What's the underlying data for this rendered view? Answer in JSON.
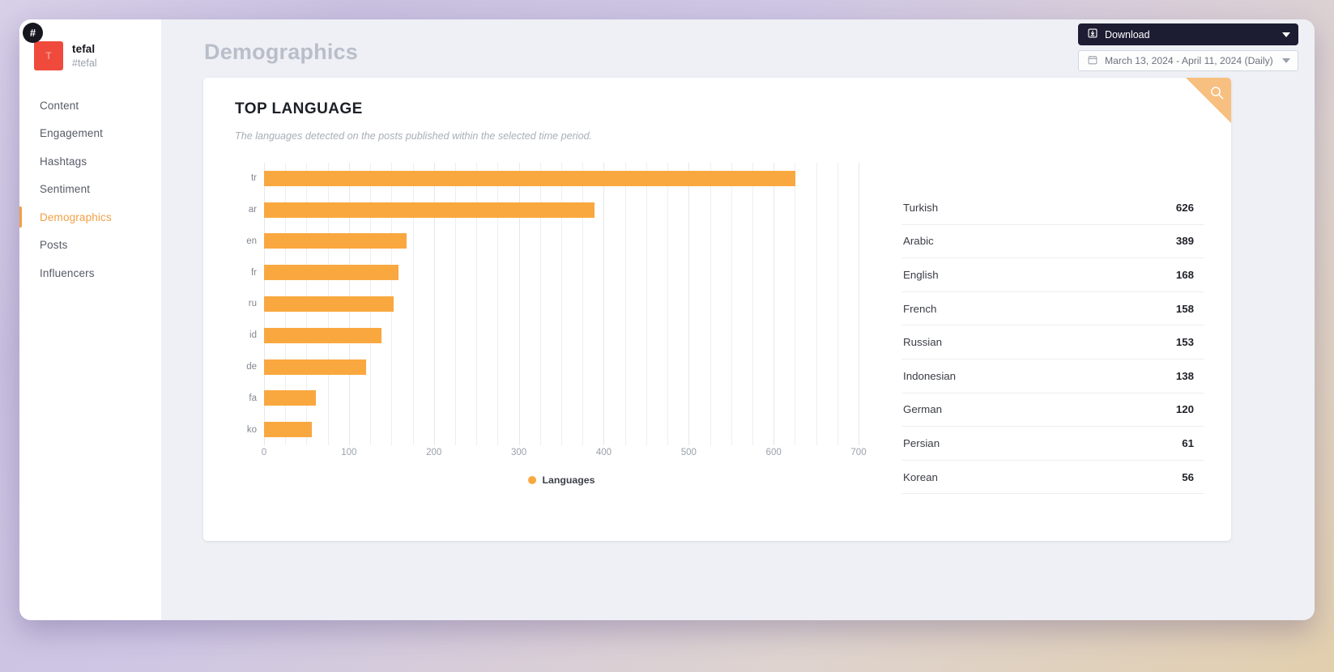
{
  "sidebar": {
    "hash_badge": "#",
    "avatar_letter": "T",
    "brand_name": "tefal",
    "brand_handle": "#tefal",
    "items": [
      {
        "label": "Content",
        "active": false
      },
      {
        "label": "Engagement",
        "active": false
      },
      {
        "label": "Hashtags",
        "active": false
      },
      {
        "label": "Sentiment",
        "active": false
      },
      {
        "label": "Demographics",
        "active": true
      },
      {
        "label": "Posts",
        "active": false
      },
      {
        "label": "Influencers",
        "active": false
      }
    ]
  },
  "header": {
    "page_title": "Demographics",
    "download_label": "Download",
    "download_icon": "download-icon",
    "date_range_label": "March 13, 2024 - April 11, 2024 (Daily)",
    "calendar_icon": "calendar-icon",
    "caret_icon": "chevron-down-icon"
  },
  "card": {
    "title": "TOP LANGUAGE",
    "subtitle": "The languages detected on the posts published within the selected time period.",
    "ribbon_icon": "search-icon"
  },
  "table": {
    "rows": [
      {
        "name": "Turkish",
        "value": "626"
      },
      {
        "name": "Arabic",
        "value": "389"
      },
      {
        "name": "English",
        "value": "168"
      },
      {
        "name": "French",
        "value": "158"
      },
      {
        "name": "Russian",
        "value": "153"
      },
      {
        "name": "Indonesian",
        "value": "138"
      },
      {
        "name": "German",
        "value": "120"
      },
      {
        "name": "Persian",
        "value": "61"
      },
      {
        "name": "Korean",
        "value": "56"
      }
    ]
  },
  "colors": {
    "bar": "#f9a83f",
    "accent": "#f0a046",
    "brand": "#ef4a3c",
    "dark": "#1c1d33"
  },
  "chart_data": {
    "type": "bar",
    "orientation": "horizontal",
    "title": "TOP LANGUAGE",
    "subtitle": "The languages detected on the posts published within the selected time period.",
    "categories": [
      "tr",
      "ar",
      "en",
      "fr",
      "ru",
      "id",
      "de",
      "fa",
      "ko"
    ],
    "values": [
      626,
      389,
      168,
      158,
      153,
      138,
      120,
      61,
      56
    ],
    "category_full_names": [
      "Turkish",
      "Arabic",
      "English",
      "French",
      "Russian",
      "Indonesian",
      "German",
      "Persian",
      "Korean"
    ],
    "series": [
      {
        "name": "Languages",
        "values": [
          626,
          389,
          168,
          158,
          153,
          138,
          120,
          61,
          56
        ]
      }
    ],
    "xlabel": "",
    "ylabel": "",
    "xlim": [
      0,
      700
    ],
    "xticks": [
      0,
      100,
      200,
      300,
      400,
      500,
      600,
      700
    ],
    "xtick_labels": [
      "0",
      "100",
      "200",
      "300",
      "400",
      "500",
      "600",
      "700"
    ],
    "minor_gridlines": true,
    "grid": true,
    "legend": {
      "position": "bottom",
      "entries": [
        "Languages"
      ]
    },
    "bar_color": "#f9a83f"
  }
}
